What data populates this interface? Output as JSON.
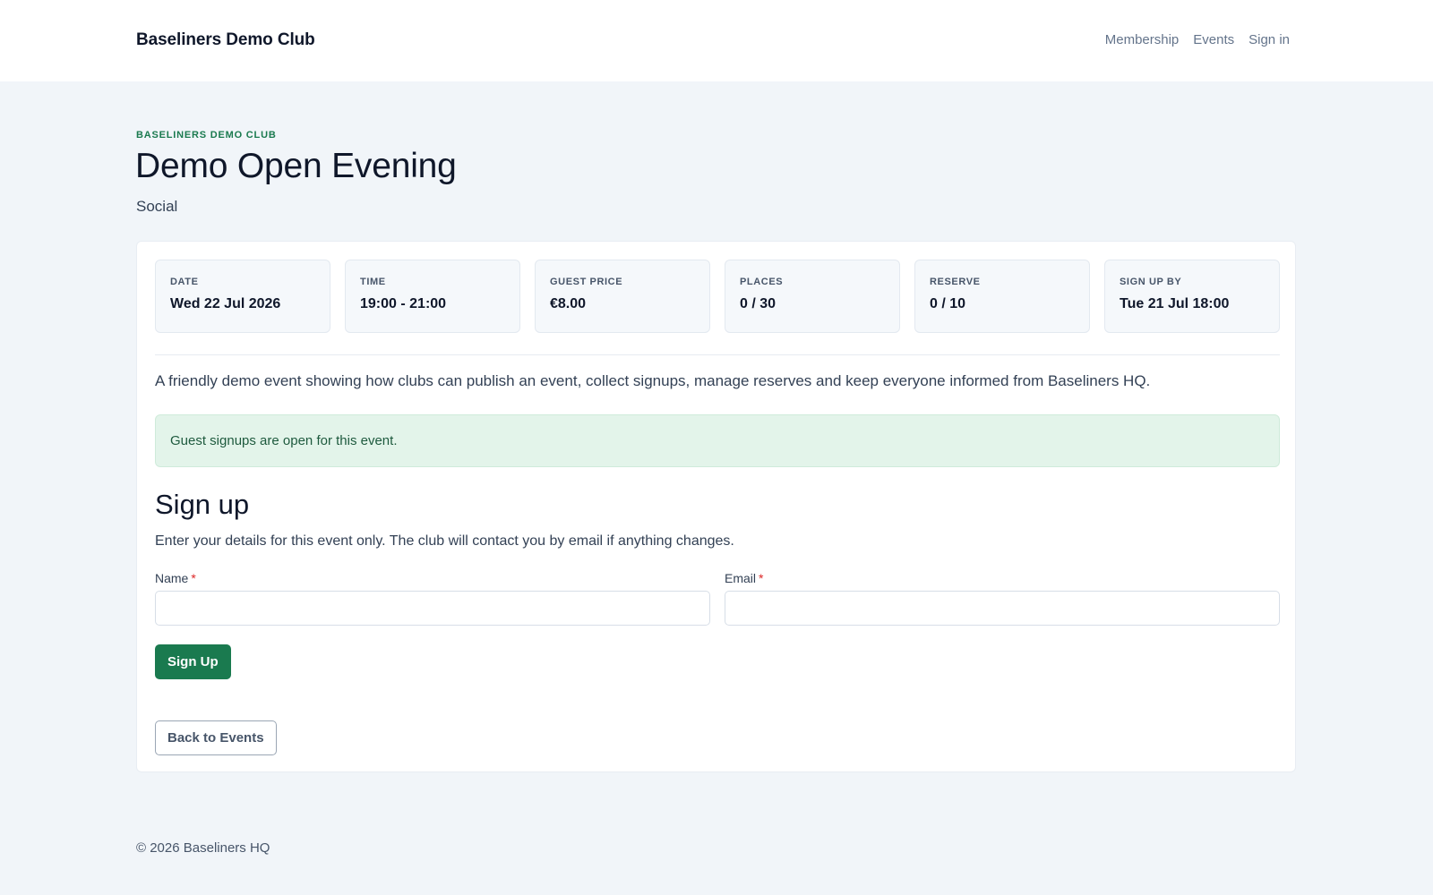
{
  "header": {
    "brand": "Baseliners Demo Club",
    "nav": [
      {
        "label": "Membership"
      },
      {
        "label": "Events"
      },
      {
        "label": "Sign in"
      }
    ]
  },
  "event": {
    "eyebrow": "Baseliners Demo Club",
    "title": "Demo Open Evening",
    "category": "Social",
    "stats": [
      {
        "label": "Date",
        "value": "Wed 22 Jul 2026"
      },
      {
        "label": "Time",
        "value": "19:00 - 21:00"
      },
      {
        "label": "Guest Price",
        "value": "€8.00"
      },
      {
        "label": "Places",
        "value": "0 / 30"
      },
      {
        "label": "Reserve",
        "value": "0 / 10"
      },
      {
        "label": "Sign up by",
        "value": "Tue 21 Jul 18:00"
      }
    ],
    "description": "A friendly demo event showing how clubs can publish an event, collect signups, manage reserves and keep everyone informed from Baseliners HQ.",
    "alert": "Guest signups are open for this event."
  },
  "signup": {
    "title": "Sign up",
    "description": "Enter your details for this event only. The club will contact you by email if anything changes.",
    "name_label": "Name",
    "name_value": "",
    "email_label": "Email",
    "email_value": "",
    "required_marker": "*",
    "submit_label": "Sign Up"
  },
  "back_label": "Back to Events",
  "footer": {
    "copyright": "© 2026 Baseliners HQ"
  },
  "colors": {
    "accent": "#1a7a4f",
    "page_background": "#f1f5f9",
    "alert_background": "#e3f4ea",
    "required": "#dc2626"
  }
}
